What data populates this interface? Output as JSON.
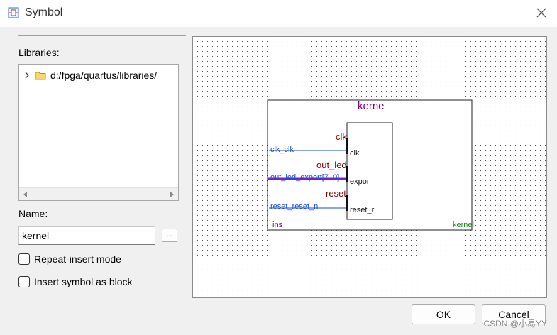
{
  "window": {
    "title": "Symbol",
    "icon": "symbol-app-icon"
  },
  "libraries": {
    "label": "Libraries:",
    "tree": [
      {
        "label": "d:/fpga/quartus/libraries/",
        "icon": "folder-icon",
        "expanded": false
      }
    ]
  },
  "name": {
    "label": "Name:",
    "value": "kernel",
    "browse_label": "..."
  },
  "options": {
    "repeat_insert": {
      "label": "Repeat-insert mode",
      "checked": false
    },
    "insert_as_block": {
      "label": "Insert symbol as block",
      "checked": false
    }
  },
  "symbol_preview": {
    "title": "kerne",
    "instance": "ins",
    "entity": "kernel",
    "ports": [
      {
        "group": "clk",
        "signal": "clk_clk",
        "pin": "clk"
      },
      {
        "group": "out_led",
        "signal": "out_led_export[7..0]",
        "pin": "expor"
      },
      {
        "group": "reset",
        "signal": "reset_reset_n",
        "pin": "reset_r"
      }
    ]
  },
  "buttons": {
    "ok": "OK",
    "cancel": "Cancel"
  },
  "watermark": "CSDN @小易YY",
  "colors": {
    "title": "#800080",
    "port": "#8b0000",
    "signal": "#1a4bd1",
    "bus": "#7a1fd6",
    "entity": "#1e8c1e"
  }
}
